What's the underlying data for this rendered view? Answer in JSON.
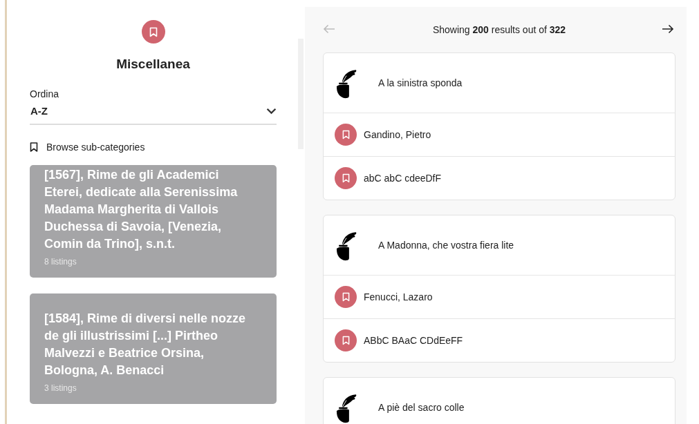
{
  "category": {
    "title": "Miscellanea"
  },
  "sort": {
    "label": "Ordina",
    "value": "A-Z"
  },
  "browse_link": "Browse sub-categories",
  "subcategories": [
    {
      "title": "[1567], Rime de gli Academici Eterei, dedicate alla Serenissima Madama Margherita di Vallois Duchessa di Savoia, [Venezia, Comin da Trino], s.n.t.",
      "count": "8 listings"
    },
    {
      "title": "[1584], Rime di diversi nelle nozze de gli illustrissimi [...] Pirtheo Malvezzi e Beatrice Orsina, Bologna, A. Benacci",
      "count": "3 listings"
    }
  ],
  "pager": {
    "prev_disabled": true,
    "text": "Showing **200** results out of **322**"
  },
  "results": [
    {
      "title": "A la sinistra sponda",
      "authors": [
        "Gandino, Pietro",
        "abC abC cdeeDfF"
      ]
    },
    {
      "title": "A Madonna, che vostra fiera lite",
      "authors": [
        "Fenucci, Lazaro",
        "ABbC BAaC CDdEeFF"
      ]
    },
    {
      "title": "A piè del sacro colle"
    }
  ]
}
